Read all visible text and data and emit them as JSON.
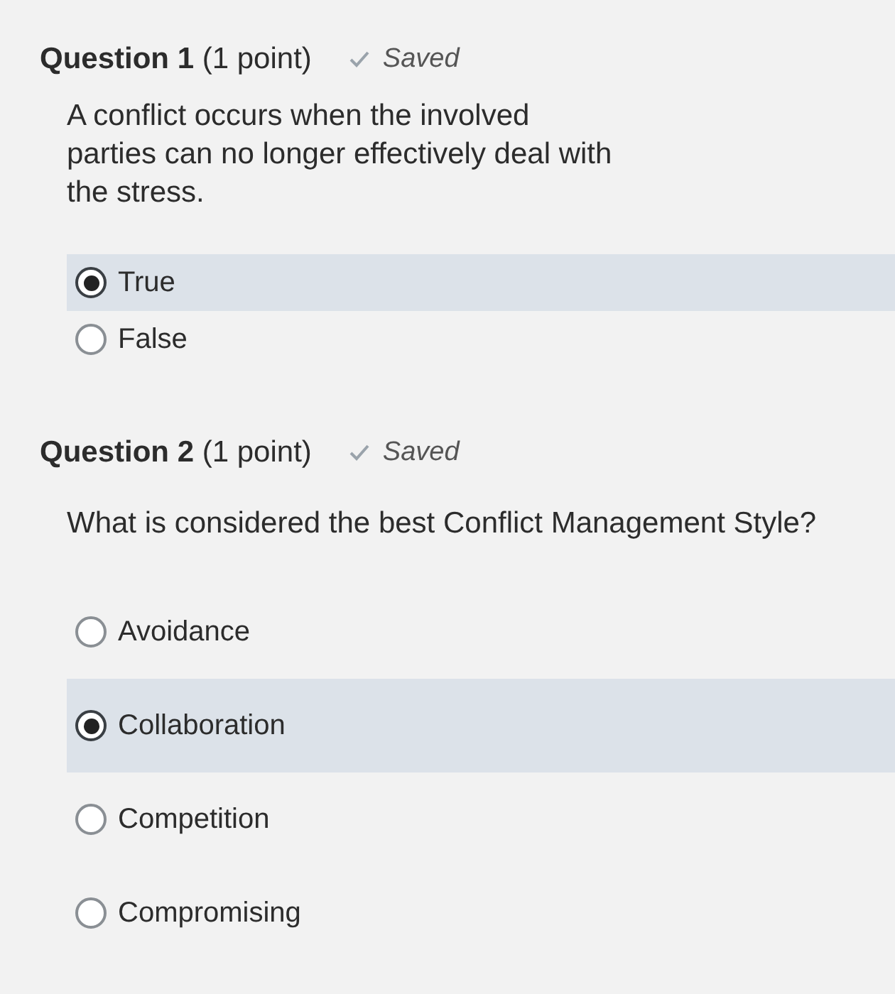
{
  "questions": [
    {
      "title": "Question 1",
      "points": "(1 point)",
      "status": "Saved",
      "prompt": "A conflict occurs when the involved parties can no longer effectively deal with the stress.",
      "options": [
        {
          "label": "True",
          "selected": true
        },
        {
          "label": "False",
          "selected": false
        }
      ]
    },
    {
      "title": "Question 2",
      "points": "(1 point)",
      "status": "Saved",
      "prompt": "What is considered the best Conflict Management Style?",
      "options": [
        {
          "label": "Avoidance",
          "selected": false
        },
        {
          "label": "Collaboration",
          "selected": true
        },
        {
          "label": "Competition",
          "selected": false
        },
        {
          "label": "Compromising",
          "selected": false
        }
      ]
    }
  ]
}
